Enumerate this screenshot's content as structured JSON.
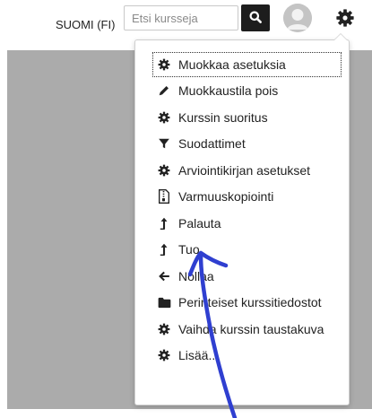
{
  "header": {
    "language": "SUOMI (FI)",
    "search_placeholder": "Etsi kursseja"
  },
  "actions_menu": {
    "items": [
      {
        "label": "Muokkaa asetuksia",
        "icon": "gear-icon"
      },
      {
        "label": "Muokkaustila pois",
        "icon": "pencil-icon"
      },
      {
        "label": "Kurssin suoritus",
        "icon": "gear-icon"
      },
      {
        "label": "Suodattimet",
        "icon": "filter-icon"
      },
      {
        "label": "Arviointikirjan asetukset",
        "icon": "gear-icon"
      },
      {
        "label": "Varmuuskopiointi",
        "icon": "file-archive-icon"
      },
      {
        "label": "Palauta",
        "icon": "upload-arrow-icon"
      },
      {
        "label": "Tuo",
        "icon": "upload-arrow-icon"
      },
      {
        "label": "Nollaa",
        "icon": "arrow-left-icon"
      },
      {
        "label": "Perinteiset kurssitiedostot",
        "icon": "folder-icon"
      },
      {
        "label": "Vaihda kurssin taustakuva",
        "icon": "gear-icon"
      },
      {
        "label": "Lisää...",
        "icon": "gear-icon"
      }
    ]
  },
  "colors": {
    "menu_text": "#222222",
    "search_button": "#1d1d1d",
    "content_background": "#ababab",
    "pen_annotation": "#2f3fd0"
  }
}
